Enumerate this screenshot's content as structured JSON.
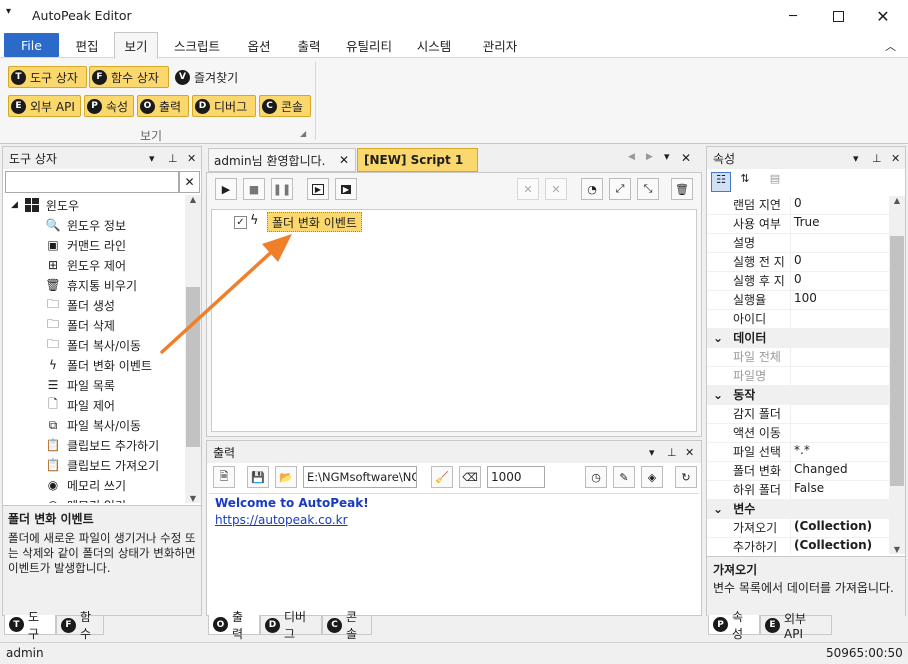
{
  "app": {
    "title": "AutoPeak Editor"
  },
  "menu": {
    "file": "File",
    "items": [
      "편집",
      "보기",
      "스크립트",
      "옵션",
      "출력",
      "유틸리티",
      "시스템",
      "관리자"
    ]
  },
  "ribbon": {
    "row1": [
      "도구 상자",
      "함수 상자",
      "즐겨찾기"
    ],
    "row2": [
      "외부 API",
      "속성",
      "출력",
      "디버그",
      "콘솔"
    ],
    "badges1": [
      "T",
      "F",
      "V"
    ],
    "badges2": [
      "E",
      "P",
      "O",
      "D",
      "C"
    ],
    "group": "보기"
  },
  "toolbox": {
    "title": "도구 상자",
    "search_value": "",
    "category": "윈도우",
    "items": [
      "윈도우 정보",
      "커맨드 라인",
      "윈도우 제어",
      "휴지통 비우기",
      "폴더 생성",
      "폴더 삭제",
      "폴더 복사/이동",
      "폴더 변화 이벤트",
      "파일 목록",
      "파일 제어",
      "파일 복사/이동",
      "클립보드 추가하기",
      "클립보드 가져오기",
      "메모리 쓰기",
      "메모리 읽기"
    ],
    "icons": [
      "magnifier-icon",
      "console-icon",
      "windows-icon",
      "trash-icon",
      "folder-add-icon",
      "folder-remove-icon",
      "folder-move-icon",
      "lightning-icon",
      "list-icon",
      "file-icon",
      "copy-icon",
      "clipboard-add-icon",
      "clipboard-get-icon",
      "memory-icon",
      "memory-icon"
    ],
    "desc_title": "폴더 변화 이벤트",
    "desc_text": "폴더에 새로운 파일이 생기거나 수정 또는 삭제와 같이 폴더의 상태가 변화하면 이벤트가 발생합니다.",
    "tabs": [
      "도구",
      "함수"
    ]
  },
  "editor": {
    "tabs": [
      "admin님 환영합니다.",
      "[NEW] Script 1"
    ],
    "node_label": "폴더 변화 이벤트"
  },
  "output": {
    "title": "출력",
    "path": "E:\\NGMsoftware\\NG",
    "count": "1000",
    "lines": [
      "Welcome to AutoPeak!",
      "https://autopeak.co.kr"
    ],
    "tabs": [
      "출력",
      "디버그",
      "콘솔"
    ],
    "badges": [
      "O",
      "D",
      "C"
    ]
  },
  "props": {
    "title": "속성",
    "rows": [
      {
        "k": "랜덤 지연",
        "v": "0",
        "t": ""
      },
      {
        "k": "사용 여부",
        "v": "True",
        "t": ""
      },
      {
        "k": "설명",
        "v": "",
        "t": ""
      },
      {
        "k": "실행 전 지",
        "v": "0",
        "t": ""
      },
      {
        "k": "실행 후 지",
        "v": "0",
        "t": ""
      },
      {
        "k": "실행율",
        "v": "100",
        "t": ""
      },
      {
        "k": "아이디",
        "v": "",
        "t": ""
      },
      {
        "k": "데이터",
        "v": "",
        "t": "grp"
      },
      {
        "k": "파일 전체",
        "v": "",
        "t": "gray"
      },
      {
        "k": "파일명",
        "v": "",
        "t": "gray"
      },
      {
        "k": "동작",
        "v": "",
        "t": "grp"
      },
      {
        "k": "감지 폴더",
        "v": "",
        "t": ""
      },
      {
        "k": "액션 이동",
        "v": "",
        "t": ""
      },
      {
        "k": "파일 선택",
        "v": "*.*",
        "t": ""
      },
      {
        "k": "폴더 변화",
        "v": "Changed",
        "t": ""
      },
      {
        "k": "하위 폴더",
        "v": "False",
        "t": ""
      },
      {
        "k": "변수",
        "v": "",
        "t": "grp"
      },
      {
        "k": "가져오기",
        "v": "(Collection)",
        "t": "bold"
      },
      {
        "k": "추가하기",
        "v": "(Collection)",
        "t": "bold"
      }
    ],
    "desc_title": "가져오기",
    "desc_text": "변수 목록에서 데이터를 가져옵니다.",
    "tabs": [
      "속성",
      "외부 API"
    ],
    "badges": [
      "P",
      "E"
    ]
  },
  "status": {
    "user": "admin",
    "time": "50965:00:50"
  },
  "colors": {
    "accent": "#2b6ac9",
    "highlight": "#fbd86e",
    "arrow": "#f07f2a",
    "link": "#1a3bbf"
  }
}
